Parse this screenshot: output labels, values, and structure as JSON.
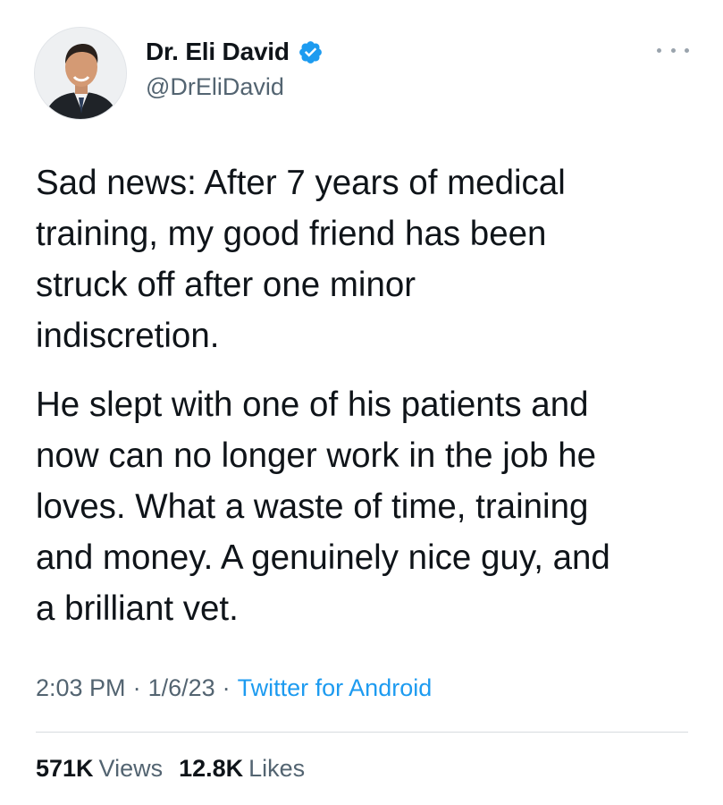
{
  "tweet": {
    "author": {
      "display_name": "Dr. Eli David",
      "handle": "@DrEliDavid",
      "verified": true
    },
    "body": [
      "Sad news: After 7 years of medical\ntraining, my good friend has been\nstruck off after one minor\nindiscretion.",
      "He slept with one of his patients and\nnow can no longer work in the job he\nloves. What a waste of time, training\nand money. A genuinely nice guy, and\na brilliant vet."
    ],
    "meta": {
      "time": "2:03 PM",
      "separator": "·",
      "date": "1/6/23",
      "source": "Twitter for Android"
    },
    "stats": {
      "views_count": "571K",
      "views_label": "Views",
      "likes_count": "12.8K",
      "likes_label": "Likes"
    }
  },
  "colors": {
    "text": "#0f1419",
    "secondary": "#536471",
    "accent": "#1d9bf0",
    "divider": "#d7dbdf"
  },
  "icons": [
    "avatar-photo",
    "verified-badge-icon",
    "more-options-icon"
  ]
}
